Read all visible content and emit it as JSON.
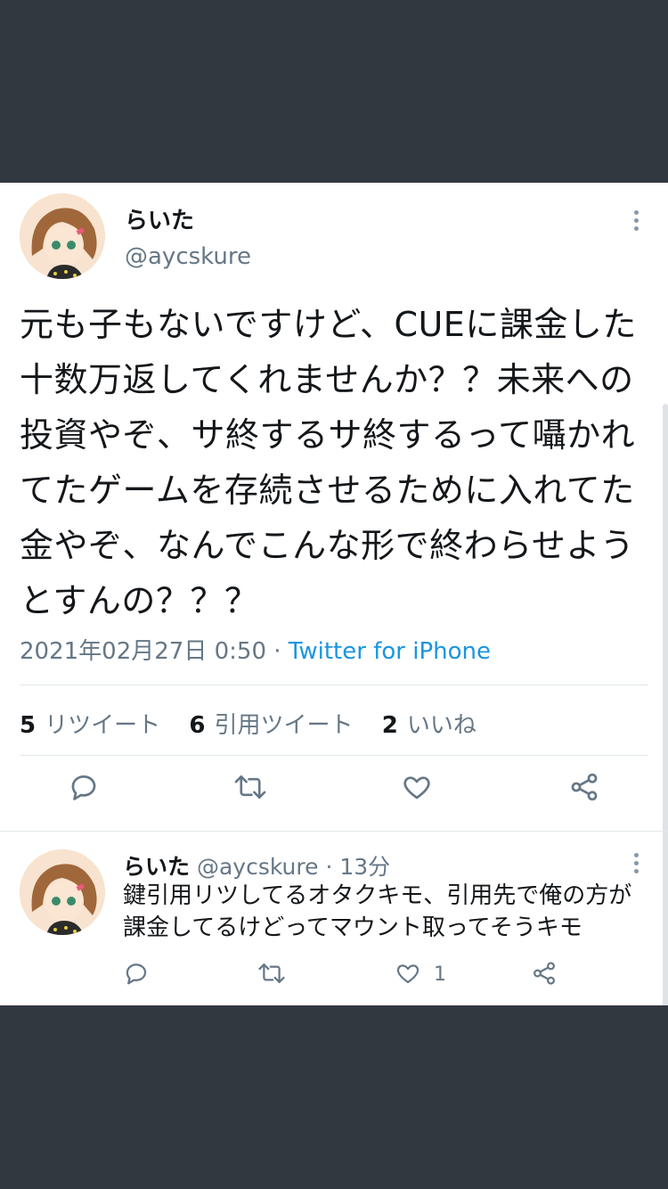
{
  "colors": {
    "accent": "#1b95e0",
    "text": "#14171a",
    "muted": "#657786",
    "background_band": "#323840"
  },
  "tweet": {
    "display_name": "らいた",
    "handle": "@aycskure",
    "text": "元も子もないですけど、CUEに課金した十数万返してくれませんか？？未来への投資やぞ、サ終するサ終するって囁かれてたゲームを存続させるために入れてた金やぞ、なんでこんな形で終わらせようとすんの？？？",
    "timestamp": "2021年02月27日 0:50",
    "separator": " · ",
    "source": "Twitter for iPhone",
    "stats": {
      "retweets_count": "5",
      "retweets_label": "リツイート",
      "quotes_count": "6",
      "quotes_label": "引用ツイート",
      "likes_count": "2",
      "likes_label": "いいね"
    },
    "actions": [
      "reply-icon",
      "retweet-icon",
      "like-icon",
      "share-icon"
    ]
  },
  "reply": {
    "display_name": "らいた",
    "handle": "@aycskure",
    "separator": " · ",
    "time": "13分",
    "text": "鍵引用リツしてるオタクキモ、引用先で俺の方が課金してるけどってマウント取ってそうキモ",
    "like_count": "1",
    "actions": [
      "reply-icon",
      "retweet-icon",
      "like-icon",
      "share-icon"
    ]
  }
}
